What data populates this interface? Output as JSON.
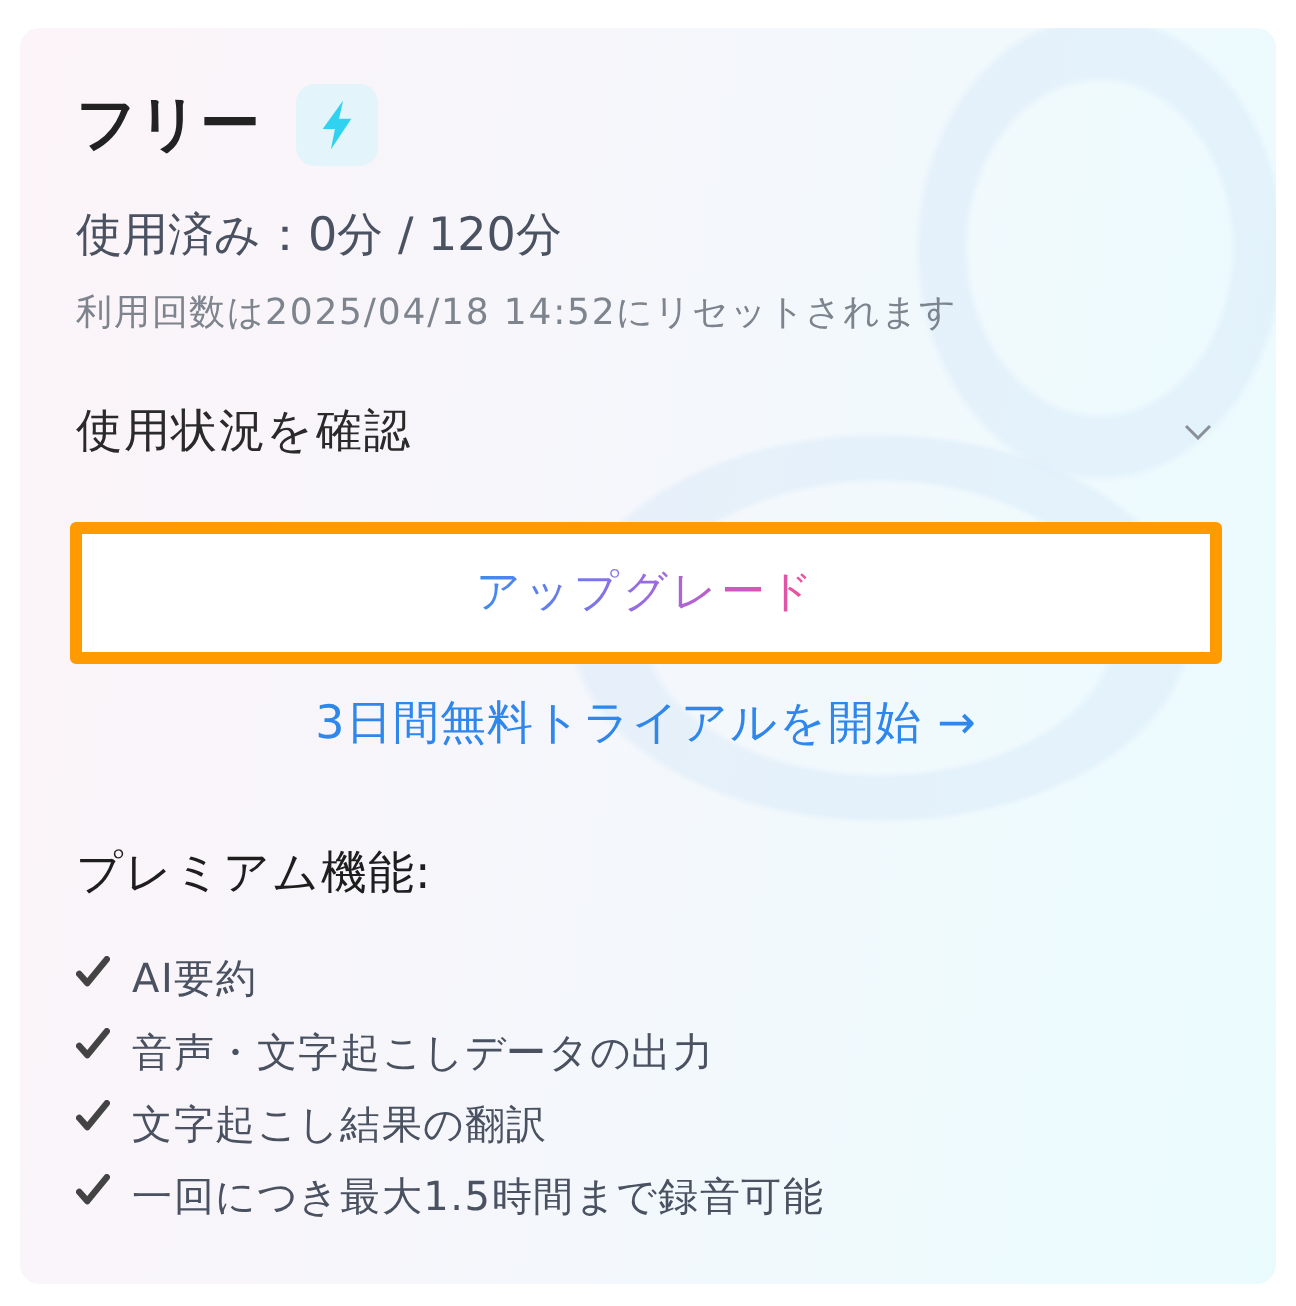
{
  "plan": {
    "name": "フリー"
  },
  "usage": {
    "text": "使用済み：0分 / 120分"
  },
  "reset_note": "利用回数は2025/04/18 14:52にリセットされます",
  "usage_details": {
    "label": "使用状況を確認",
    "expanded": false
  },
  "upgrade_button": {
    "label": "アップグレード",
    "highlighted": true
  },
  "trial_link": {
    "label": "3日間無料トライアルを開始 →"
  },
  "premium": {
    "heading": "プレミアム機能:",
    "features": [
      "AI要約",
      "音声・文字起こしデータの出力",
      "文字起こし結果の翻訳",
      "一回につき最大1.5時間まで録音可能"
    ]
  }
}
